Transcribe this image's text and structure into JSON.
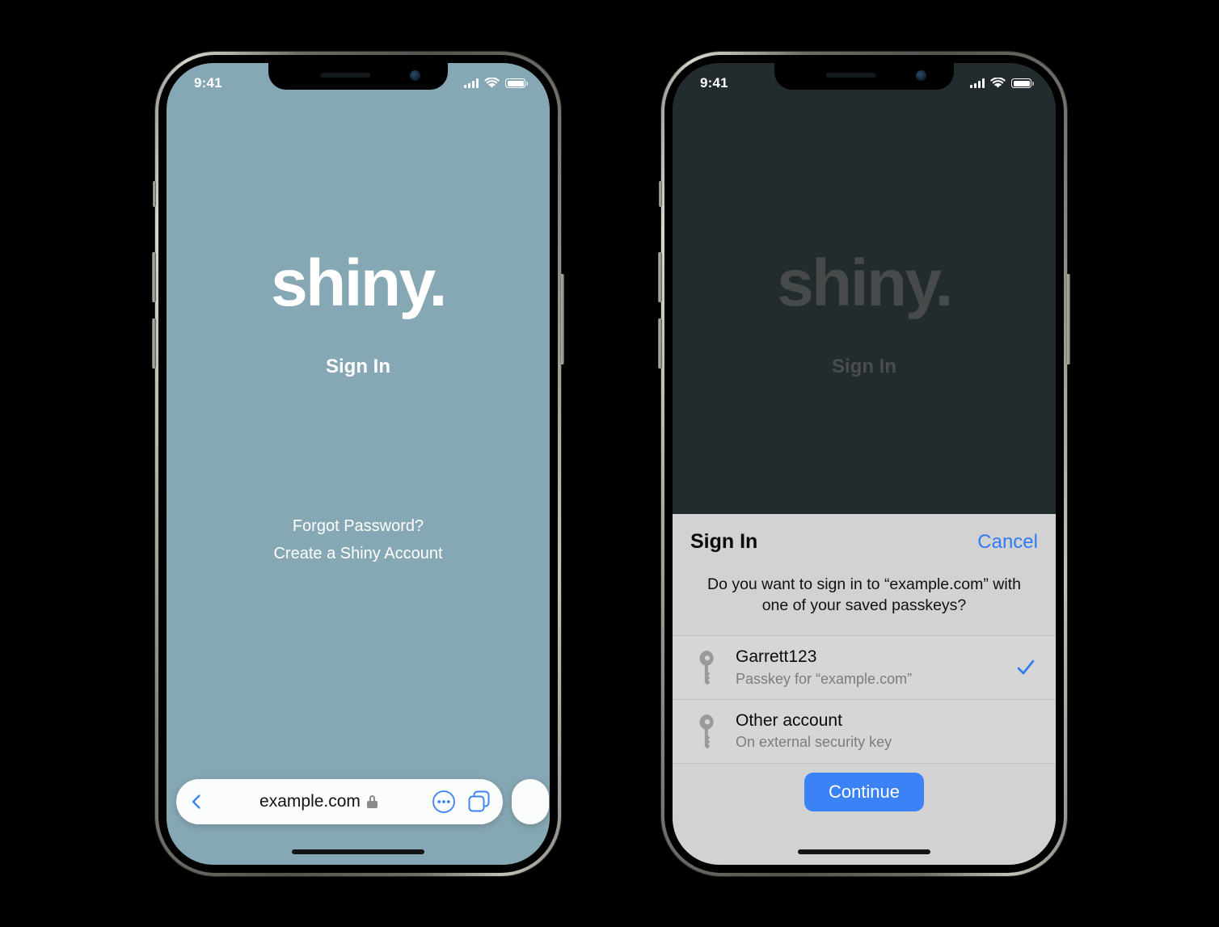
{
  "status_bar": {
    "time": "9:41",
    "cellular_icon": "cellular-bars-icon",
    "wifi_icon": "wifi-icon",
    "battery_icon": "battery-full-icon"
  },
  "website": {
    "brand": "shiny.",
    "heading": "Sign In",
    "links": [
      {
        "label": "Forgot Password?"
      },
      {
        "label": "Create a Shiny Account"
      }
    ]
  },
  "safari": {
    "back_icon": "back-chevron-icon",
    "url": "example.com",
    "lock_icon": "lock-icon",
    "more_icon": "more-ellipsis-circle-icon",
    "tabs_icon": "tabs-overview-icon"
  },
  "passkey_sheet": {
    "title": "Sign In",
    "cancel_label": "Cancel",
    "prompt": "Do you want to sign in to “example.com” with one of your saved passkeys?",
    "accounts": [
      {
        "icon": "key-icon",
        "title": "Garrett123",
        "subtitle": "Passkey for “example.com”",
        "selected_icon": "checkmark-icon",
        "selected": true
      },
      {
        "icon": "key-icon",
        "title": "Other account",
        "subtitle": "On external security key",
        "selected": false
      }
    ],
    "continue_label": "Continue"
  },
  "colors": {
    "page_background": "#86a7b4",
    "page_background_dimmed": "#222c2e",
    "sheet_background": "#d2d2d2",
    "accent_blue": "#3b82f6",
    "cancel_blue": "#2f7cf6",
    "canvas": "#000000"
  }
}
